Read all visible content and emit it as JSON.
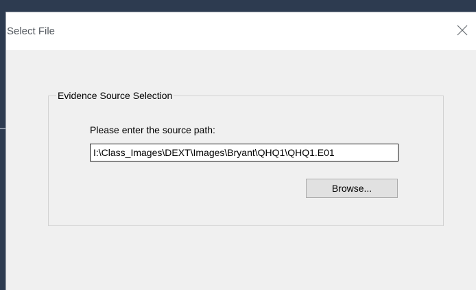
{
  "window": {
    "title": "Select File",
    "close_icon": "close-icon"
  },
  "group": {
    "legend": "Evidence Source Selection",
    "prompt": "Please enter the source path:",
    "path_value": "I:\\Class_Images\\DEXT\\Images\\Bryant\\QHQ1\\QHQ1.E01",
    "browse_label": "Browse..."
  },
  "colors": {
    "backdrop": "#2d3b50",
    "dialog_bg": "#f0f0f0",
    "titlebar_bg": "#ffffff",
    "button_bg": "#e1e1e1"
  }
}
